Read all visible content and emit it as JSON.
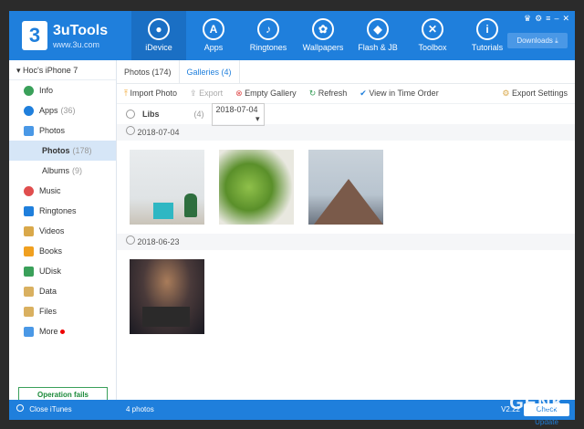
{
  "app": {
    "brand": "3uTools",
    "url": "www.3u.com",
    "logo": "3"
  },
  "nav": [
    {
      "label": "iDevice",
      "icon": "apple-icon",
      "active": true
    },
    {
      "label": "Apps",
      "icon": "app-store-icon"
    },
    {
      "label": "Ringtones",
      "icon": "bell-icon"
    },
    {
      "label": "Wallpapers",
      "icon": "flower-icon"
    },
    {
      "label": "Flash & JB",
      "icon": "dropbox-icon"
    },
    {
      "label": "Toolbox",
      "icon": "tools-icon"
    },
    {
      "label": "Tutorials",
      "icon": "info-icon"
    }
  ],
  "downloads": "Downloads",
  "device": "Hoc's iPhone 7",
  "sidebar": {
    "items": [
      {
        "label": "Info",
        "color": "#3aa05a"
      },
      {
        "label": "Apps",
        "count": "(36)",
        "color": "#1f7fdc"
      },
      {
        "label": "Photos",
        "color": "#4a98e6"
      },
      {
        "label": "Photos",
        "count": "(178)",
        "sub": true,
        "active": true
      },
      {
        "label": "Albums",
        "count": "(9)",
        "sub": true
      },
      {
        "label": "Music",
        "color": "#e04e4e"
      },
      {
        "label": "Ringtones",
        "color": "#1f7fdc"
      },
      {
        "label": "Videos",
        "color": "#d9a84a"
      },
      {
        "label": "Books",
        "color": "#f0a020"
      },
      {
        "label": "UDisk",
        "color": "#3aa05a"
      },
      {
        "label": "Data",
        "color": "#d9b060"
      },
      {
        "label": "Files",
        "color": "#d9b060"
      },
      {
        "label": "More",
        "color": "#4a98e6"
      }
    ],
    "warning": "Operation fails Frequently?",
    "close": "Close iTunes"
  },
  "tabs": [
    {
      "label": "Photos (174)"
    },
    {
      "label": "Galleries (4)",
      "active": true
    }
  ],
  "toolbar": {
    "import": "Import Photo",
    "export": "Export",
    "empty": "Empty Gallery",
    "refresh": "Refresh",
    "view": "View in Time Order",
    "settings": "Export Settings"
  },
  "filter": {
    "label": "Libs",
    "count": "(4)",
    "date": "2018-07-04"
  },
  "groups": [
    {
      "date": "2018-07-04",
      "count": 3
    },
    {
      "date": "2018-06-23",
      "count": 1
    }
  ],
  "status": {
    "photos": "4 photos",
    "version": "V2.22",
    "update": "Check Update"
  },
  "watermark": "GENK"
}
